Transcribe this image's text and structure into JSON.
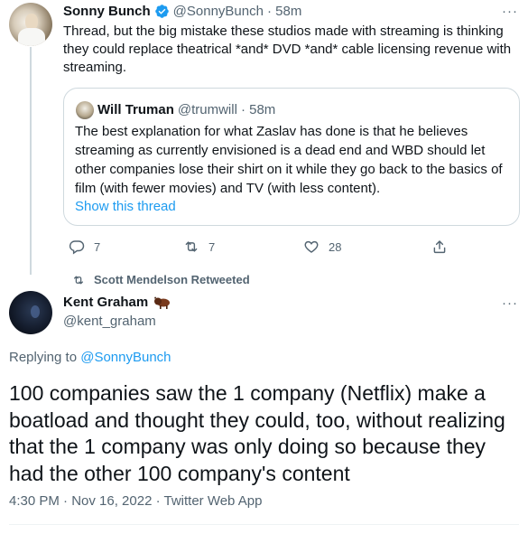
{
  "tweet1": {
    "name": "Sonny Bunch",
    "handle": "@SonnyBunch",
    "time": "· 58m",
    "text": "Thread, but the big mistake these studios made with streaming is thinking they could replace theatrical *and* DVD *and* cable licensing revenue with streaming.",
    "more": "···"
  },
  "quote": {
    "name": "Will Truman",
    "handle": "@trumwill",
    "time": "· 58m",
    "text": "The best explanation for what Zaslav has done is that he believes streaming as currently envisioned is a dead end and WBD should let other companies lose their shirt on it while they go back to the basics of film (with fewer movies) and TV (with less content).",
    "show_thread": "Show this thread"
  },
  "actions": {
    "replies": "7",
    "retweets": "7",
    "likes": "28"
  },
  "retweeted_by": "Scott Mendelson Retweeted",
  "tweet2": {
    "name": "Kent Graham",
    "handle": "@kent_graham",
    "more": "···",
    "replying_prefix": "Replying to",
    "replying_to": "@SonnyBunch",
    "text": "100 companies saw the 1 company (Netflix) make a boatload and thought they could, too, without realizing that the 1 company was only doing so because they had the other 100 company's content",
    "timestamp": "4:30 PM · Nov 16, 2022 · Twitter Web App"
  },
  "colors": {
    "accent": "#1d9bf0",
    "muted": "#536471",
    "text": "#0f1419",
    "border": "#cfd9de"
  }
}
